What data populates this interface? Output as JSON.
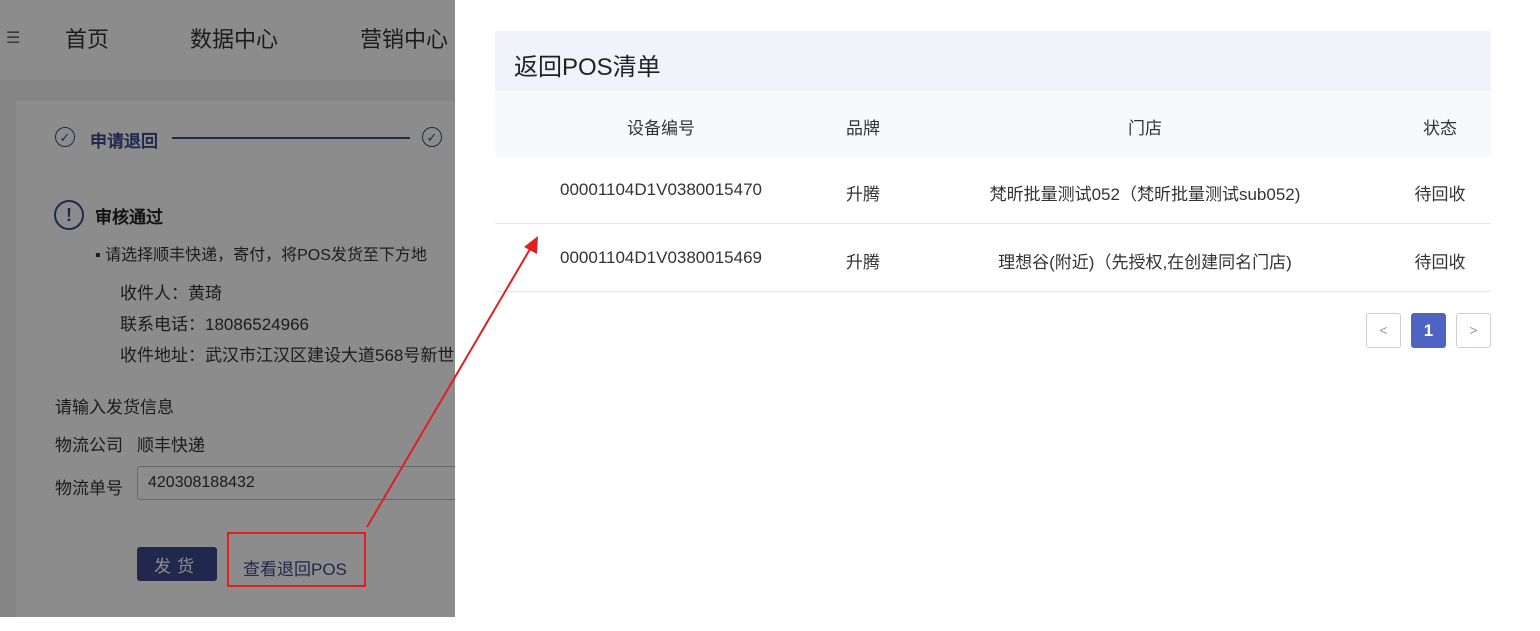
{
  "nav": {
    "menu_icon": "menu-collapse-icon",
    "items": [
      "首页",
      "数据中心",
      "营销中心"
    ]
  },
  "steps": {
    "step1_label": "申请退回",
    "check_icon": "check-circle-icon"
  },
  "alert": {
    "icon": "exclamation-circle-icon",
    "title": "审核通过",
    "instruction": "请选择顺丰快递，寄付，将POS发货至下方地",
    "recipient": "收件人：黄琦",
    "phone": "联系电话：18086524966",
    "address": "收件地址：武汉市江汉区建设大道568号新世"
  },
  "form": {
    "heading": "请输入发货信息",
    "carrier_label": "物流公司",
    "carrier_value": "顺丰快递",
    "tracking_label": "物流单号",
    "tracking_value": "420308188432",
    "ship_button": "发货",
    "view_pos_link": "查看退回POS"
  },
  "drawer": {
    "title": "返回POS清单",
    "columns": [
      "设备编号",
      "品牌",
      "门店",
      "状态"
    ],
    "rows": [
      [
        "00001104D1V0380015470",
        "升腾",
        "梵昕批量测试052（梵昕批量测试sub052)",
        "待回收"
      ],
      [
        "00001104D1V0380015469",
        "升腾",
        "理想谷(附近)（先授权,在创建同名门店)",
        "待回收"
      ]
    ],
    "pagination": {
      "prev_icon": "chevron-left-icon",
      "current_page": "1",
      "next_icon": "chevron-right-icon"
    }
  },
  "annotation": {
    "color": "#e02020"
  }
}
